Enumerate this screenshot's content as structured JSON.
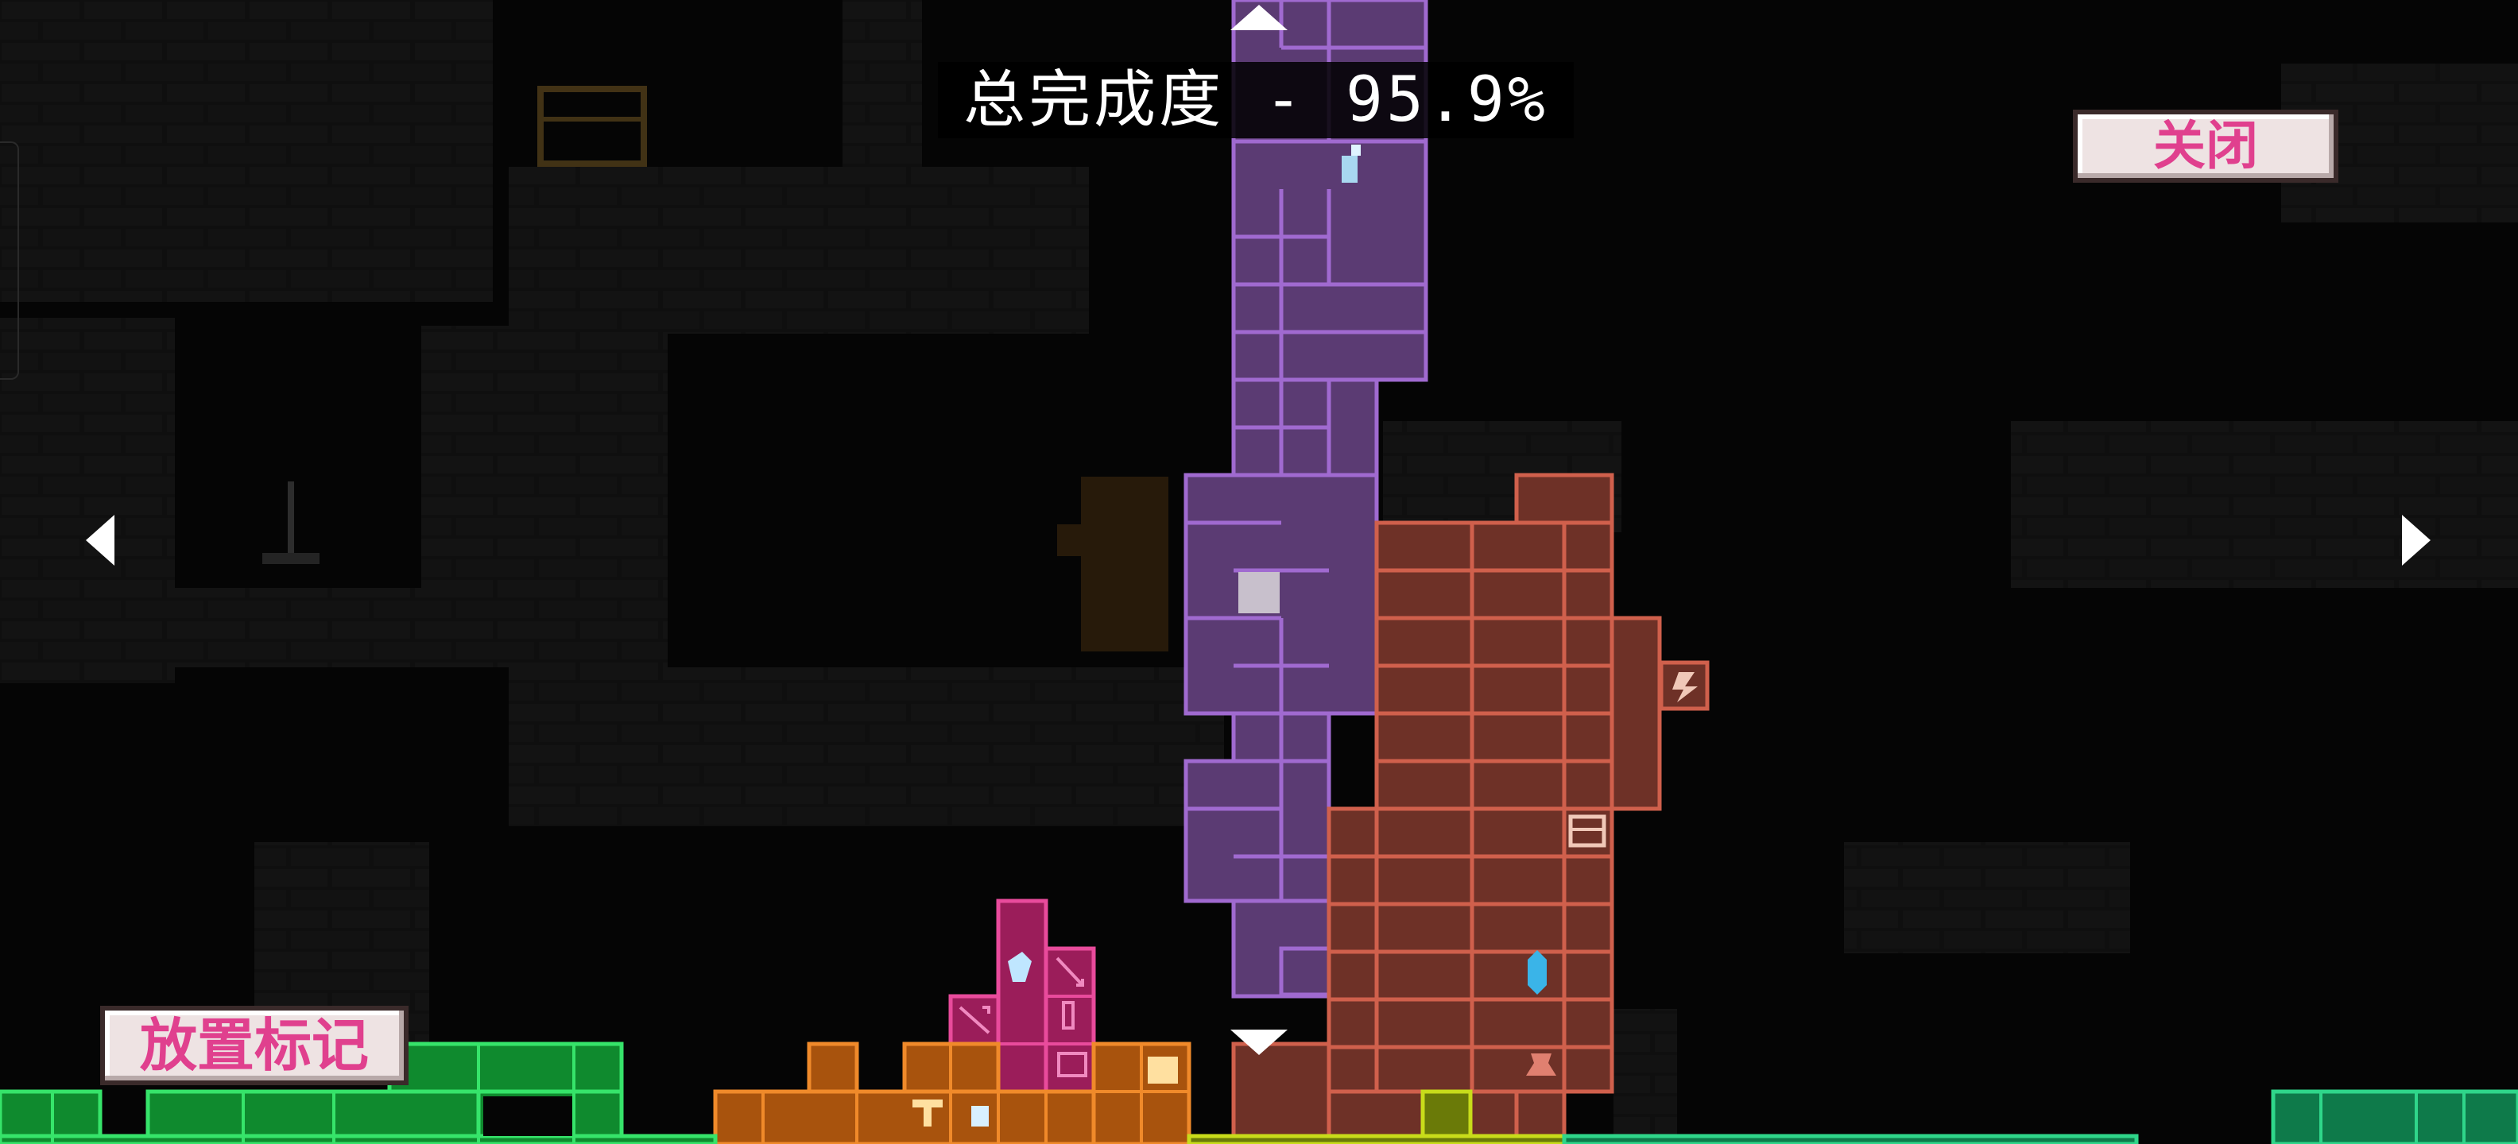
{
  "hud": {
    "completion_text": "总完成度 - 95.9%",
    "completion_percent": 95.9,
    "close_label": "关闭",
    "place_marker_label": "放置标记"
  },
  "colors": {
    "zone_purple": "#5b3b73",
    "zone_purple_line": "#a06ad0",
    "zone_brown": "#6e3127",
    "zone_brown_line": "#d0604c",
    "zone_magenta": "#9b1d5a",
    "zone_magenta_line": "#e94b9c",
    "zone_orange": "#a8530d",
    "zone_orange_line": "#f08a2a",
    "zone_green": "#0f8a2e",
    "zone_green_line": "#36e46a",
    "zone_teal": "#0e7a4a",
    "zone_teal_line": "#2fd68a",
    "zone_olive": "#6a7a08",
    "zone_olive_line": "#c8dc1a",
    "button_face": "#eee3e3",
    "button_text": "#e0408e"
  },
  "icons": [
    "arrow-left-icon",
    "arrow-right-icon",
    "arrow-up-icon",
    "arrow-down-icon",
    "potion-icon",
    "crystal-icon",
    "lightning-icon",
    "chest-icon",
    "vase-icon",
    "teleporter-icon",
    "boot-icon",
    "shield-icon",
    "armor-icon",
    "current-room-marker-icon"
  ]
}
